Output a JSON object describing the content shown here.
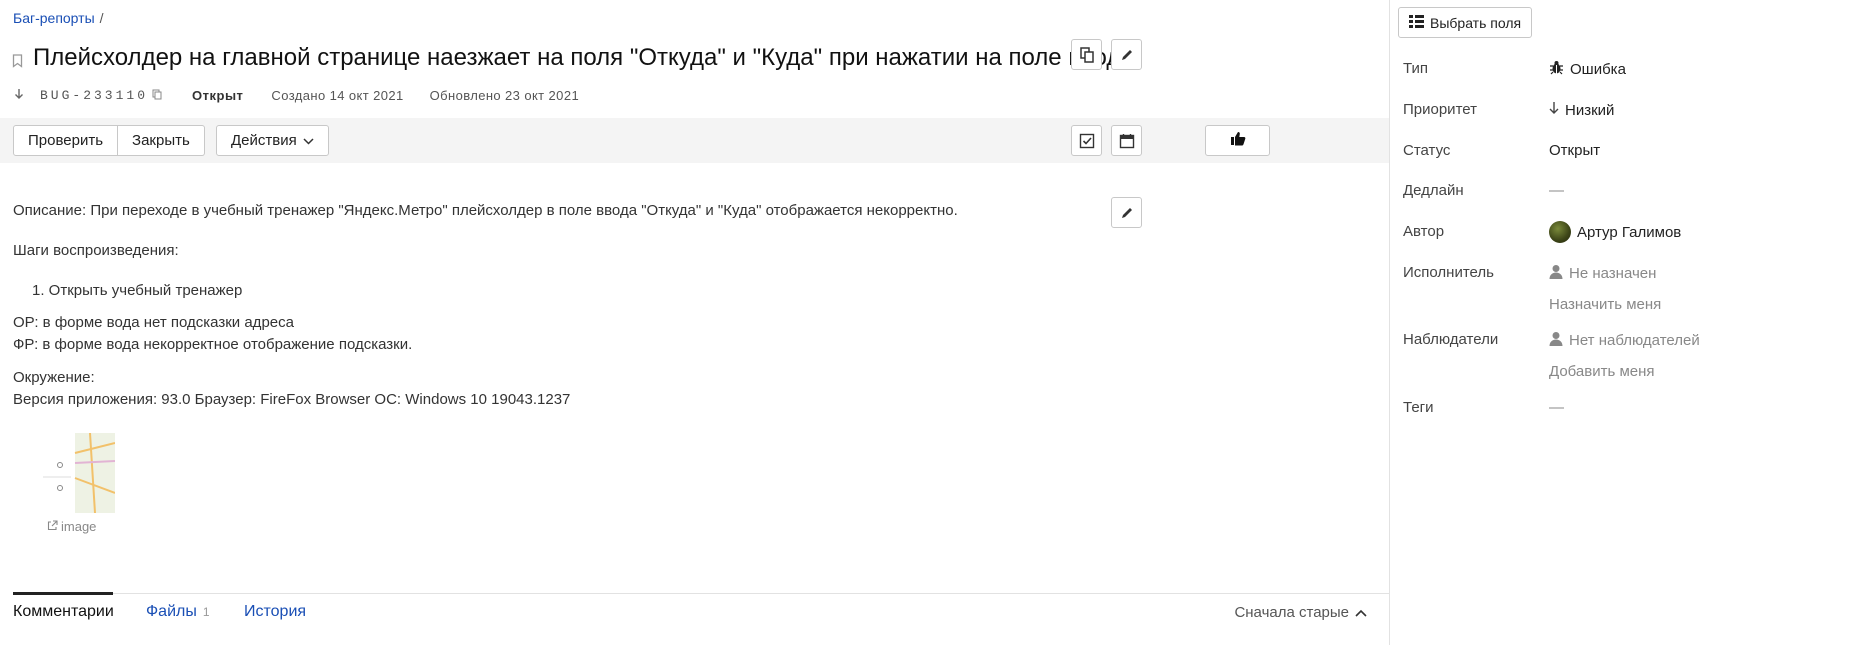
{
  "breadcrumb": {
    "link": "Баг-репорты",
    "separator": "/"
  },
  "issue": {
    "title": "Плейсхолдер на главной странице наезжает на поля \"Откуда\" и \"Куда\" при нажатии на поле ввода.",
    "key": "BUG-233110",
    "status": "Открыт",
    "created": "Создано 14 окт 2021",
    "updated": "Обновлено 23 окт 2021"
  },
  "toolbar": {
    "check_label": "Проверить",
    "close_label": "Закрыть",
    "actions_label": "Действия"
  },
  "description": {
    "line1": "Описание: При переходе в учебный тренажер \"Яндекс.Метро\" плейсхолдер в поле ввода \"Откуда\" и \"Куда\" отображается некорректно.",
    "steps_title": "Шаги воспроизведения:",
    "step1": "1. Открыть учебный тренажер",
    "expected": "ОР: в форме вода нет подсказки адреса",
    "actual": "ФР: в форме вода некорректное отображение подсказки.",
    "env_title": "Окружение:",
    "env": "Версия приложения: 93.0 Браузер: FireFox Browser ОС: Windows 10 19043.1237"
  },
  "attachment": {
    "label": "image"
  },
  "tabs": {
    "comments": "Комментарии",
    "files": "Файлы",
    "files_count": "1",
    "history": "История",
    "sort": "Сначала старые"
  },
  "sidebar": {
    "choose_fields": "Выбрать поля",
    "type_label": "Тип",
    "type_value": "Ошибка",
    "priority_label": "Приоритет",
    "priority_value": "Низкий",
    "status_label": "Статус",
    "status_value": "Открыт",
    "deadline_label": "Дедлайн",
    "deadline_value": "—",
    "author_label": "Автор",
    "author_value": "Артур Галимов",
    "assignee_label": "Исполнитель",
    "assignee_value": "Не назначен",
    "assign_me": "Назначить меня",
    "watchers_label": "Наблюдатели",
    "watchers_value": "Нет наблюдателей",
    "add_me": "Добавить меня",
    "tags_label": "Теги",
    "tags_value": "—"
  },
  "colors": {
    "link": "#1a4fb5",
    "toolbar_bg": "#f4f4f4",
    "border": "#c8c8c8"
  },
  "icons": [
    "bookmark-icon",
    "priority-down-icon",
    "copy-key-icon",
    "copy-link-icon",
    "edit-icon",
    "like-icon",
    "checklist-icon",
    "calendar-icon",
    "chevron-down-icon",
    "chevron-up-icon",
    "external-link-icon",
    "bug-icon",
    "user-icon",
    "fields-icon"
  ]
}
